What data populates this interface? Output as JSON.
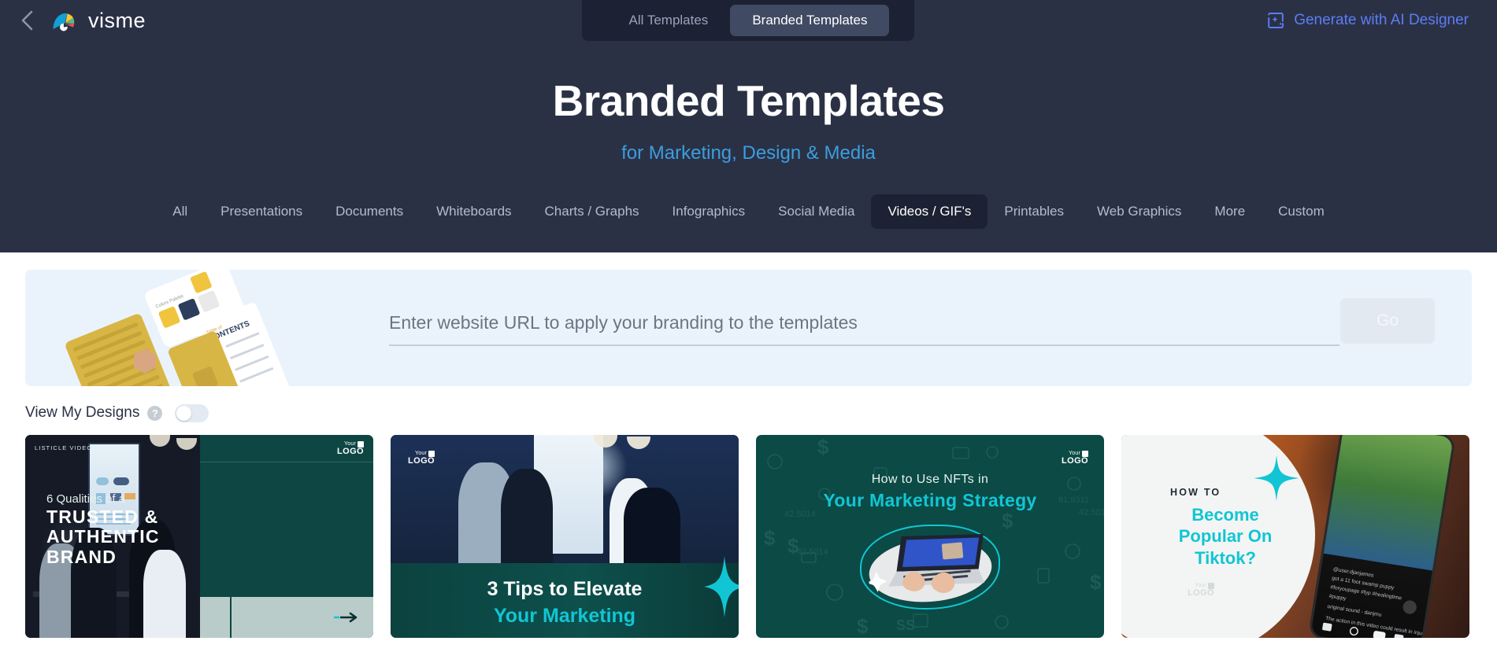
{
  "topbar": {
    "back_icon": "chevron-left-icon",
    "brand_name": "visme",
    "brand_logo_icon": "visme-fan-logo-icon",
    "segments": [
      {
        "label": "All Templates",
        "active": false
      },
      {
        "label": "Branded Templates",
        "active": true
      }
    ],
    "ai_designer": {
      "label": "Generate with AI Designer",
      "icon": "ai-sparkle-frame-icon",
      "color": "#5b7df5"
    }
  },
  "hero": {
    "title": "Branded Templates",
    "subtitle": "for Marketing, Design & Media",
    "title_color": "#ffffff",
    "subtitle_color": "#3b9ede",
    "background": "#2b3145"
  },
  "categories": [
    {
      "label": "All",
      "active": false
    },
    {
      "label": "Presentations",
      "active": false
    },
    {
      "label": "Documents",
      "active": false
    },
    {
      "label": "Whiteboards",
      "active": false
    },
    {
      "label": "Charts / Graphs",
      "active": false
    },
    {
      "label": "Infographics",
      "active": false
    },
    {
      "label": "Social Media",
      "active": false
    },
    {
      "label": "Videos / GIF's",
      "active": true
    },
    {
      "label": "Printables",
      "active": false
    },
    {
      "label": "Web Graphics",
      "active": false
    },
    {
      "label": "More",
      "active": false
    },
    {
      "label": "Custom",
      "active": false
    }
  ],
  "url_panel": {
    "input_value": "",
    "input_placeholder": "Enter website URL to apply your branding to the templates",
    "go_label": "Go",
    "background": "#eaf3fc",
    "art_icon": "brand-kit-cards-illustration"
  },
  "view_my_designs": {
    "label": "View My Designs",
    "help_icon": "question-mark-icon",
    "help_glyph": "?",
    "toggle_on": false
  },
  "cards": [
    {
      "name": "trusted-authentic-brand",
      "kicker": "LISTICLE VIDEO",
      "eyebrow": "6 Qualities of a",
      "headline": "TRUSTED &\nAUTHENTIC\nBRAND",
      "headline_lines": [
        "TRUSTED &",
        "AUTHENTIC",
        "BRAND"
      ],
      "logo_top": "Your",
      "logo_bottom": "LOGO",
      "arrow_icon": "arrow-right-icon",
      "accent": "#0d4643"
    },
    {
      "name": "3-tips-to-elevate-your-marketing",
      "line1": "3 Tips to Elevate",
      "line2": "Your Marketing",
      "logo_top": "Your",
      "logo_bottom": "LOGO",
      "spark_icon": "four-point-star-icon",
      "accent": "#12c5d4"
    },
    {
      "name": "how-to-use-nfts",
      "line1": "How to Use NFTs in",
      "line2": "Your Marketing Strategy",
      "logo_top": "Your",
      "logo_bottom": "LOGO",
      "accent": "#12c5d4"
    },
    {
      "name": "become-popular-on-tiktok",
      "kicker": "HOW TO",
      "headline_lines": [
        "Become",
        "Popular On",
        "Tiktok?"
      ],
      "logo_top": "Your",
      "logo_bottom": "LOGO",
      "spark_icon": "four-point-star-icon",
      "accent": "#12c5d4"
    }
  ]
}
